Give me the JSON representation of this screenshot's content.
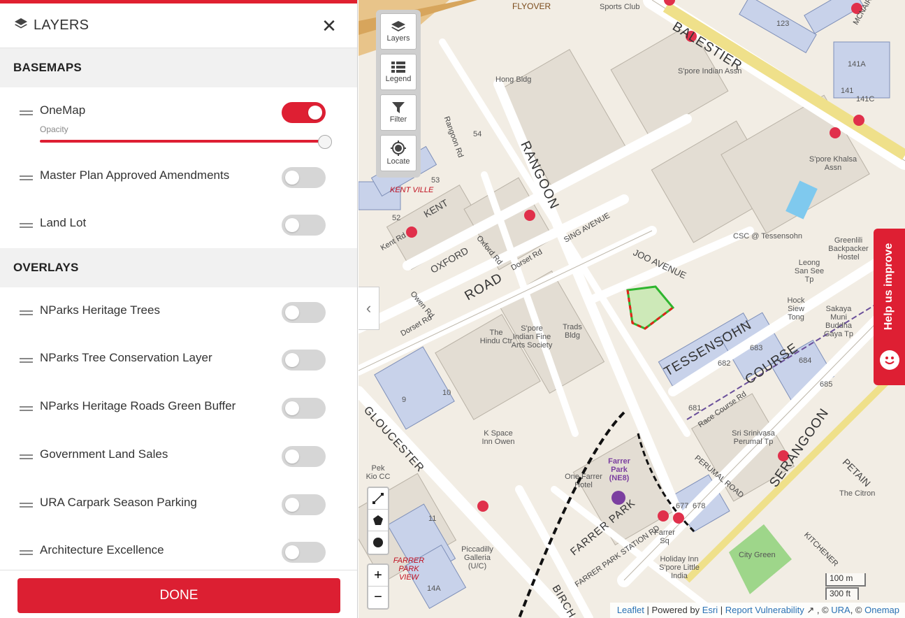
{
  "panel": {
    "title": "LAYERS",
    "close_symbol": "✕",
    "basemaps_heading": "BASEMAPS",
    "overlays_heading": "OVERLAYS",
    "opacity_label": "Opacity",
    "opacity_value": 1.0,
    "basemaps": [
      {
        "label": "OneMap",
        "enabled": true
      },
      {
        "label": "Master Plan Approved Amendments",
        "enabled": false
      },
      {
        "label": "Land Lot",
        "enabled": false
      }
    ],
    "overlays": [
      {
        "label": "NParks Heritage Trees",
        "enabled": false
      },
      {
        "label": "NParks Tree Conservation Layer",
        "enabled": false
      },
      {
        "label": "NParks Heritage Roads Green Buffer",
        "enabled": false
      },
      {
        "label": "Government Land Sales",
        "enabled": false
      },
      {
        "label": "URA Carpark Season Parking",
        "enabled": false
      },
      {
        "label": "Architecture Excellence",
        "enabled": false
      }
    ],
    "done_label": "DONE"
  },
  "toolbar": {
    "layers": "Layers",
    "legend": "Legend",
    "filter": "Filter",
    "locate": "Locate"
  },
  "zoom": {
    "in": "+",
    "out": "−"
  },
  "help": {
    "label": "Help us improve"
  },
  "scale": {
    "metric": "100 m",
    "imperial": "300 ft"
  },
  "attribution": {
    "leaflet": "Leaflet",
    "powered_by": " | Powered by ",
    "esri": "Esri",
    "sep": " | ",
    "report": "Report Vulnerability",
    "comma1": " , © ",
    "ura": "URA",
    "comma2": ", © ",
    "onemap": "Onemap"
  },
  "map_labels": {
    "flyover": "FLYOVER",
    "sports_club": "Sports Club",
    "balestier": "BALESTIER",
    "mcnair": "MCNAIR",
    "spore_indian_assn": "S'pore Indian Assn",
    "rangoon_rd": "Rangoon Rd",
    "rangoon": "RANGOON",
    "road": "ROAD",
    "hong_bldg": "Hong Bldg",
    "kent_ville": "KENT VILLE",
    "kent_rd": "Kent Rd",
    "kent": "KENT",
    "oxford": "OXFORD",
    "oxford_rd": "Oxford Rd",
    "dorset_rd": "Dorset Rd",
    "owen_rd": "Owen Rd",
    "sing_avenue": "SING AVENUE",
    "joo_avenue": "JOO AVENUE",
    "tessensohn": "TESSENSOHN",
    "course": "COURSE",
    "race_course_rd": "Race Course Rd",
    "serangoon": "SERANGOON",
    "petain": "PETAIN",
    "csc_tessensohn": "CSC @ Tessensohn",
    "spore_khalsa_assn": "S'pore Khalsa Assn",
    "the_hindu_ctr": "The Hindu Ctr",
    "spore_indian_fine_arts": "S'pore Indian Fine Arts Society",
    "trads_bldg": "Trads Bldg",
    "k_space": "K Space Inn Owen",
    "farrer_park": "Farrer Park (NE8)",
    "one_farrer_hotel": "One Farrer Hotel",
    "farrer_park_rd": "FARRER PARK",
    "farrer_park_station_rd": "FARRER PARK STATION RD",
    "farrer_sq": "Farrer Sq",
    "holiday_inn": "Holiday Inn S'pore Little India",
    "piccadilly": "Piccadilly Galleria (U/C)",
    "farrer_park_view": "FARRER PARK VIEW",
    "pek_kio_cc": "Pek Kio CC",
    "gloucester": "GLOUCESTER",
    "sri_srinivasa": "Sri Srinivasa Perumal Tp",
    "perumal_road": "PERUMAL ROAD",
    "birch": "BIRCH",
    "city_green": "City Green",
    "kitchener": "KITCHENER",
    "the_citron": "The Citron",
    "sakaya_muni": "Sakaya Muni Buddha Gaya Tp",
    "leong_san_see_tp": "Leong San See Tp",
    "hock_siew_tong": "Hock Siew Tong",
    "greenlili": "Greenlili Backpacker Hostel",
    "lok_682": "682",
    "lok_683": "683",
    "lok_684": "684",
    "lok_685": "685",
    "lok_681": "681",
    "lok_141a": "141A",
    "lok_141c": "141C",
    "lok_141": "141",
    "lok_123": "123",
    "lok_53": "53",
    "lok_52": "52",
    "lok_54": "54",
    "lok_9": "9",
    "lok_10": "10",
    "lok_11": "11",
    "lok_14a": "14A",
    "lok_677": "677",
    "lok_678": "678"
  }
}
